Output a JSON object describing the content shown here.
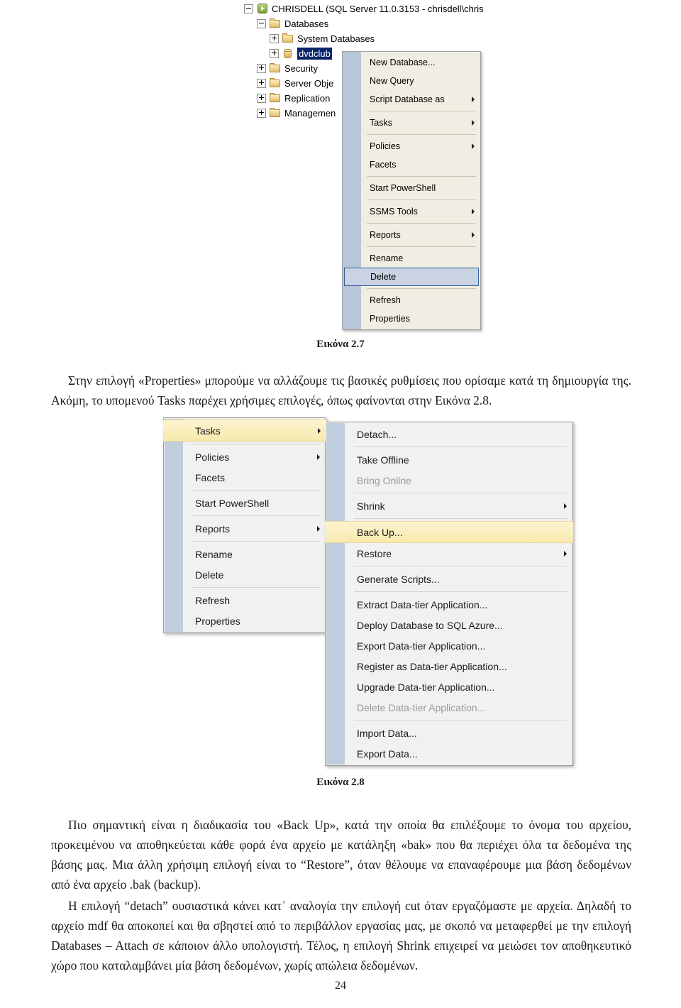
{
  "figure_27": {
    "tree": [
      {
        "level": 0,
        "expander": "minus",
        "icon": "server-icon",
        "label": "CHRISDELL (SQL Server 11.0.3153 - chrisdell\\chris",
        "selected": false
      },
      {
        "level": 1,
        "expander": "minus",
        "icon": "folder-icon",
        "label": "Databases",
        "selected": false
      },
      {
        "level": 2,
        "expander": "plus",
        "icon": "folder-icon",
        "label": "System Databases",
        "selected": false
      },
      {
        "level": 2,
        "expander": "plus",
        "icon": "database-icon",
        "label": "dvdclub",
        "selected": true
      },
      {
        "level": 1,
        "expander": "plus",
        "icon": "folder-icon",
        "label": "Security",
        "selected": false
      },
      {
        "level": 1,
        "expander": "plus",
        "icon": "folder-icon",
        "label": "Server Obje",
        "selected": false
      },
      {
        "level": 1,
        "expander": "plus",
        "icon": "folder-icon",
        "label": "Replication",
        "selected": false
      },
      {
        "level": 1,
        "expander": "plus",
        "icon": "folder-icon",
        "label": "Managemen",
        "selected": false
      }
    ],
    "context_menu": [
      {
        "type": "item",
        "label": "New Database...",
        "submenu": false,
        "state": "normal"
      },
      {
        "type": "item",
        "label": "New Query",
        "submenu": false,
        "state": "normal"
      },
      {
        "type": "item",
        "label": "Script Database as",
        "submenu": true,
        "state": "normal"
      },
      {
        "type": "separator"
      },
      {
        "type": "item",
        "label": "Tasks",
        "submenu": true,
        "state": "normal"
      },
      {
        "type": "separator"
      },
      {
        "type": "item",
        "label": "Policies",
        "submenu": true,
        "state": "normal"
      },
      {
        "type": "item",
        "label": "Facets",
        "submenu": false,
        "state": "normal"
      },
      {
        "type": "separator"
      },
      {
        "type": "item",
        "label": "Start PowerShell",
        "submenu": false,
        "state": "normal"
      },
      {
        "type": "separator"
      },
      {
        "type": "item",
        "label": "SSMS Tools",
        "submenu": true,
        "state": "normal"
      },
      {
        "type": "separator"
      },
      {
        "type": "item",
        "label": "Reports",
        "submenu": true,
        "state": "normal"
      },
      {
        "type": "separator"
      },
      {
        "type": "item",
        "label": "Rename",
        "submenu": false,
        "state": "normal"
      },
      {
        "type": "item",
        "label": "Delete",
        "submenu": false,
        "state": "selected"
      },
      {
        "type": "separator"
      },
      {
        "type": "item",
        "label": "Refresh",
        "submenu": false,
        "state": "normal"
      },
      {
        "type": "item",
        "label": "Properties",
        "submenu": false,
        "state": "normal"
      }
    ]
  },
  "caption_27": "Εικόνα 2.7",
  "paragraph_1": "Στην επιλογή «Properties» μπορούμε να αλλάζουμε τις βασικές ρυθμίσεις που ορίσαμε κατά τη δημιουργία της. Ακόμη, το υπομενού Tasks παρέχει χρήσιμες επιλογές, όπως φαίνονται στην Εικόνα 2.8.",
  "figure_28": {
    "parent_menu": [
      {
        "type": "item",
        "label": "Tasks",
        "submenu": true,
        "state": "highlighted"
      },
      {
        "type": "separator"
      },
      {
        "type": "item",
        "label": "Policies",
        "submenu": true,
        "state": "normal"
      },
      {
        "type": "item",
        "label": "Facets",
        "submenu": false,
        "state": "normal"
      },
      {
        "type": "separator"
      },
      {
        "type": "item",
        "label": "Start PowerShell",
        "submenu": false,
        "state": "normal"
      },
      {
        "type": "separator"
      },
      {
        "type": "item",
        "label": "Reports",
        "submenu": true,
        "state": "normal"
      },
      {
        "type": "separator"
      },
      {
        "type": "item",
        "label": "Rename",
        "submenu": false,
        "state": "normal"
      },
      {
        "type": "item",
        "label": "Delete",
        "submenu": false,
        "state": "normal"
      },
      {
        "type": "separator"
      },
      {
        "type": "item",
        "label": "Refresh",
        "submenu": false,
        "state": "normal"
      },
      {
        "type": "item",
        "label": "Properties",
        "submenu": false,
        "state": "normal"
      }
    ],
    "tasks_submenu": [
      {
        "type": "item",
        "label": "Detach...",
        "submenu": false,
        "state": "normal"
      },
      {
        "type": "separator"
      },
      {
        "type": "item",
        "label": "Take Offline",
        "submenu": false,
        "state": "normal"
      },
      {
        "type": "item",
        "label": "Bring Online",
        "submenu": false,
        "state": "disabled"
      },
      {
        "type": "separator"
      },
      {
        "type": "item",
        "label": "Shrink",
        "submenu": true,
        "state": "normal"
      },
      {
        "type": "separator"
      },
      {
        "type": "item",
        "label": "Back Up...",
        "submenu": false,
        "state": "highlighted"
      },
      {
        "type": "item",
        "label": "Restore",
        "submenu": true,
        "state": "normal"
      },
      {
        "type": "separator"
      },
      {
        "type": "item",
        "label": "Generate Scripts...",
        "submenu": false,
        "state": "normal"
      },
      {
        "type": "separator"
      },
      {
        "type": "item",
        "label": "Extract Data-tier Application...",
        "submenu": false,
        "state": "normal"
      },
      {
        "type": "item",
        "label": "Deploy Database to SQL Azure...",
        "submenu": false,
        "state": "normal"
      },
      {
        "type": "item",
        "label": "Export Data-tier Application...",
        "submenu": false,
        "state": "normal"
      },
      {
        "type": "item",
        "label": "Register as Data-tier Application...",
        "submenu": false,
        "state": "normal"
      },
      {
        "type": "item",
        "label": "Upgrade Data-tier Application...",
        "submenu": false,
        "state": "normal"
      },
      {
        "type": "item",
        "label": "Delete Data-tier Application...",
        "submenu": false,
        "state": "disabled"
      },
      {
        "type": "separator"
      },
      {
        "type": "item",
        "label": "Import Data...",
        "submenu": false,
        "state": "normal"
      },
      {
        "type": "item",
        "label": "Export Data...",
        "submenu": false,
        "state": "normal"
      }
    ]
  },
  "caption_28": "Εικόνα 2.8",
  "paragraph_2": "Πιο σημαντική είναι η διαδικασία του «Back Up», κατά την οποία θα επιλέξουμε το όνομα του αρχείου, προκειμένου να αποθηκεύεται κάθε φορά ένα αρχείο με κατάληξη «bak» που θα περιέχει όλα τα δεδομένα της βάσης μας. Μια άλλη χρήσιμη επιλογή είναι το “Restore”, όταν θέλουμε να επαναφέρουμε μια βάση δεδομένων από ένα αρχείο .bak (backup).",
  "paragraph_3": "Η επιλογή “detach” ουσιαστικά κάνει κατ᾽ αναλογία την επιλογή cut όταν εργαζόμαστε με αρχεία. Δηλαδή το αρχείο mdf θα αποκοπεί και θα σβηστεί από το περιβάλλον εργασίας μας, με σκοπό να μεταφερθεί με την επιλογή Databases – Attach σε κάποιον άλλο υπολογιστή. Τέλος, η επιλογή Shrink επιχειρεί να μειώσει τον αποθηκευτικό χώρο που καταλαμβάνει μία βάση δεδομένων, χωρίς απώλεια δεδομένων.",
  "page_number": "24",
  "colors": {
    "selection_blue": "#0a246a",
    "menu_gutter": "#bfcddd",
    "highlight_yellow": "#f7e9ae",
    "menu_background": "#f1f1f1",
    "classic_menu_background": "#f0ede2",
    "disabled_text": "#9a9a9a"
  }
}
